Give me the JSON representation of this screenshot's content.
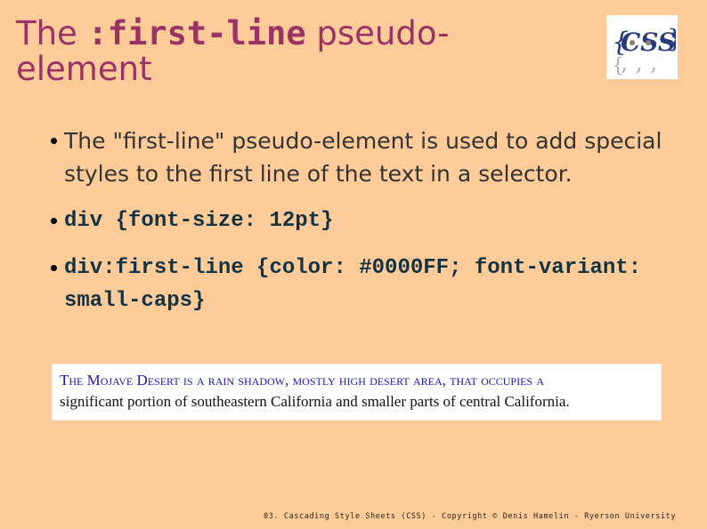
{
  "title": {
    "prefix": "The ",
    "code": ":first-line",
    "suffix": " pseudo-element"
  },
  "logo": {
    "text": "CSS",
    "icon": "css-logo-icon"
  },
  "bullets": [
    "The \"first-line\" pseudo-element is used to add special styles to the first line of the text in a selector.",
    "div {font-size: 12pt}",
    "div:first-line {color: #0000FF; font-variant: small-caps}"
  ],
  "example": {
    "first_line": "The Mojave Desert is a rain shadow, mostly high desert area, that occupies a",
    "rest": "significant portion of southeastern California and smaller parts of central California.",
    "first_line_color": "#0000FF"
  },
  "footer": "03. Cascading Style Sheets (CSS) - Copyright © Denis Hamelin - Ryerson University",
  "colors": {
    "background": "#FFCC99",
    "title": "#993366"
  }
}
